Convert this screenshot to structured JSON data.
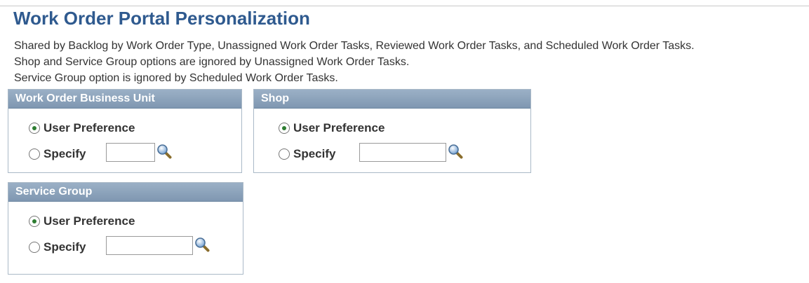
{
  "page": {
    "title": "Work Order Portal Personalization",
    "description": [
      "Shared by Backlog by Work Order Type, Unassigned Work Order Tasks, Reviewed Work Order Tasks, and Scheduled Work Order Tasks.",
      "Shop and Service Group options are ignored by Unassigned Work Order Tasks.",
      "Service Group option is ignored by Scheduled Work Order Tasks."
    ]
  },
  "groups": {
    "business_unit": {
      "title": "Work Order Business Unit",
      "user_preference_label": "User Preference",
      "specify_label": "Specify",
      "selected": "User Preference",
      "value": ""
    },
    "shop": {
      "title": "Shop",
      "user_preference_label": "User Preference",
      "specify_label": "Specify",
      "selected": "User Preference",
      "value": ""
    },
    "service_group": {
      "title": "Service Group",
      "user_preference_label": "User Preference",
      "specify_label": "Specify",
      "selected": "User Preference",
      "value": ""
    }
  },
  "icons": {
    "lookup": "magnifier-icon"
  },
  "colors": {
    "title": "#2f5a8f",
    "header_bg": "#8aa2bb",
    "radio_dot": "#2e7d32"
  }
}
